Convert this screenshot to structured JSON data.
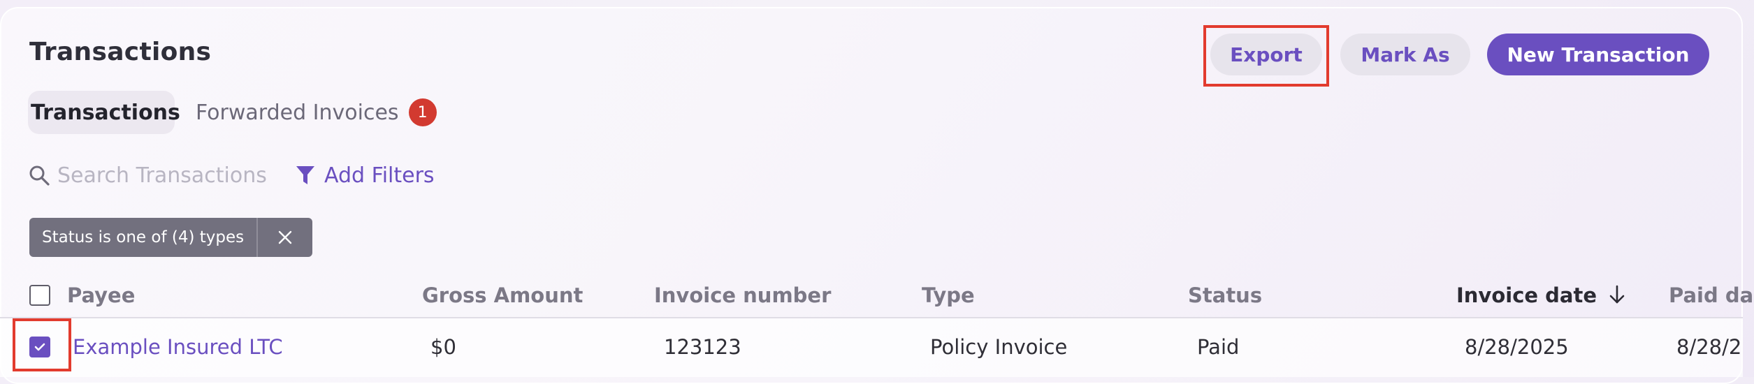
{
  "page": {
    "title": "Transactions"
  },
  "toolbar": {
    "export_label": "Export",
    "mark_as_label": "Mark As",
    "new_transaction_label": "New Transaction"
  },
  "tabs": [
    {
      "label": "Transactions",
      "active": true
    },
    {
      "label": "Forwarded Invoices",
      "badge": "1"
    }
  ],
  "search": {
    "placeholder": "Search Transactions",
    "value": "",
    "icon": "search-icon"
  },
  "filters": {
    "add_label": "Add Filters",
    "icon": "filter-icon",
    "active_chip": "Status is one of (4) types"
  },
  "table": {
    "columns": [
      {
        "label": "Payee"
      },
      {
        "label": "Gross Amount"
      },
      {
        "label": "Invoice number"
      },
      {
        "label": "Type"
      },
      {
        "label": "Status"
      },
      {
        "label": "Invoice date",
        "sort": "descending",
        "sort_icon": "arrow-down-icon"
      },
      {
        "label": "Paid da"
      }
    ],
    "rows": [
      {
        "selected": true,
        "payee": "Example Insured LTC",
        "gross_amount": "$0",
        "invoice_number": "123123",
        "type": "Policy Invoice",
        "status": "Paid",
        "invoice_date": "8/28/2025",
        "paid_date": "8/28/2"
      }
    ]
  },
  "colors": {
    "accent": "#6a4fc0",
    "badge": "#d23a30",
    "chip_bg": "#72707e",
    "highlight": "#e23b2e"
  }
}
